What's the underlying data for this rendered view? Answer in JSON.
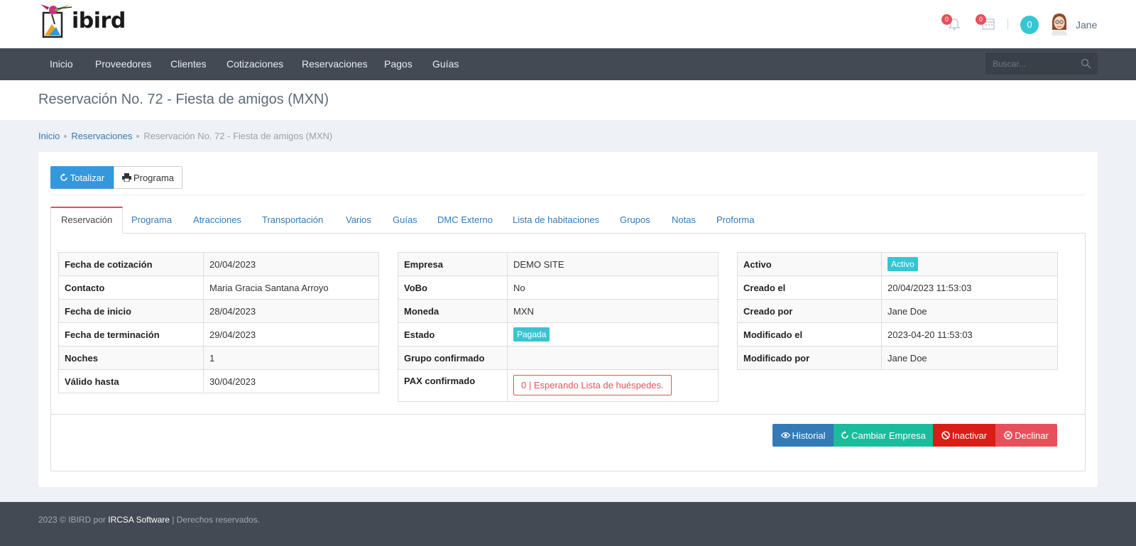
{
  "header": {
    "logo_text": "ibird",
    "notifications_count": "0",
    "calendar_count": "0",
    "chat_count": "0",
    "user_name": "Jane"
  },
  "nav": {
    "items": [
      "Inicio",
      "Proveedores",
      "Clientes",
      "Cotizaciones",
      "Reservaciones",
      "Pagos",
      "Guías"
    ],
    "search_placeholder": "Buscar..."
  },
  "page": {
    "title": "Reservación No. 72 - Fiesta de amigos (MXN)"
  },
  "breadcrumb": {
    "items": [
      "Inicio",
      "Reservaciones"
    ],
    "current": "Reservación No. 72 - Fiesta de amigos (MXN)"
  },
  "toolbar": {
    "totalizar_label": "Totalizar",
    "programa_label": "Programa"
  },
  "tabs": [
    "Reservación",
    "Programa",
    "Atracciones",
    "Transportación",
    "Varios",
    "Guías",
    "DMC Externo",
    "Lista de habitaciones",
    "Grupos",
    "Notas",
    "Proforma"
  ],
  "details_left": [
    {
      "label": "Fecha de cotización",
      "value": "20/04/2023"
    },
    {
      "label": "Contacto",
      "value": "Maria Gracia Santana Arroyo"
    },
    {
      "label": "Fecha de inicio",
      "value": "28/04/2023"
    },
    {
      "label": "Fecha de terminación",
      "value": "29/04/2023"
    },
    {
      "label": "Noches",
      "value": "1"
    },
    {
      "label": "Válido hasta",
      "value": "30/04/2023"
    }
  ],
  "details_middle": [
    {
      "label": "Empresa",
      "value": "DEMO SITE"
    },
    {
      "label": "VoBo",
      "value": "No"
    },
    {
      "label": "Moneda",
      "value": "MXN"
    },
    {
      "label": "Estado",
      "value": "Pagada"
    },
    {
      "label": "Grupo confirmado",
      "value": ""
    },
    {
      "label": "PAX confirmado",
      "value": "0 | Esperando Lista de huéspedes."
    }
  ],
  "details_right": [
    {
      "label": "Activo",
      "value": "Activo"
    },
    {
      "label": "Creado el",
      "value": "20/04/2023 11:53:03"
    },
    {
      "label": "Creado por",
      "value": "Jane Doe"
    },
    {
      "label": "Modificado el",
      "value": "2023-04-20 11:53:03"
    },
    {
      "label": "Modificado por",
      "value": "Jane Doe"
    }
  ],
  "actions": {
    "historial": "Historial",
    "cambiar_empresa": "Cambiar Empresa",
    "inactivar": "Inactivar",
    "declinar": "Declinar"
  },
  "footer": {
    "prefix": "2023 © IBIRD por",
    "brand": "IRCSA Software",
    "suffix": " |  Derechos reservados."
  },
  "colors": {
    "primary": "#3598dc",
    "nav_bg": "#434a54",
    "danger": "#e7505a",
    "info": "#36c6d3",
    "success": "#1bbc9b"
  }
}
